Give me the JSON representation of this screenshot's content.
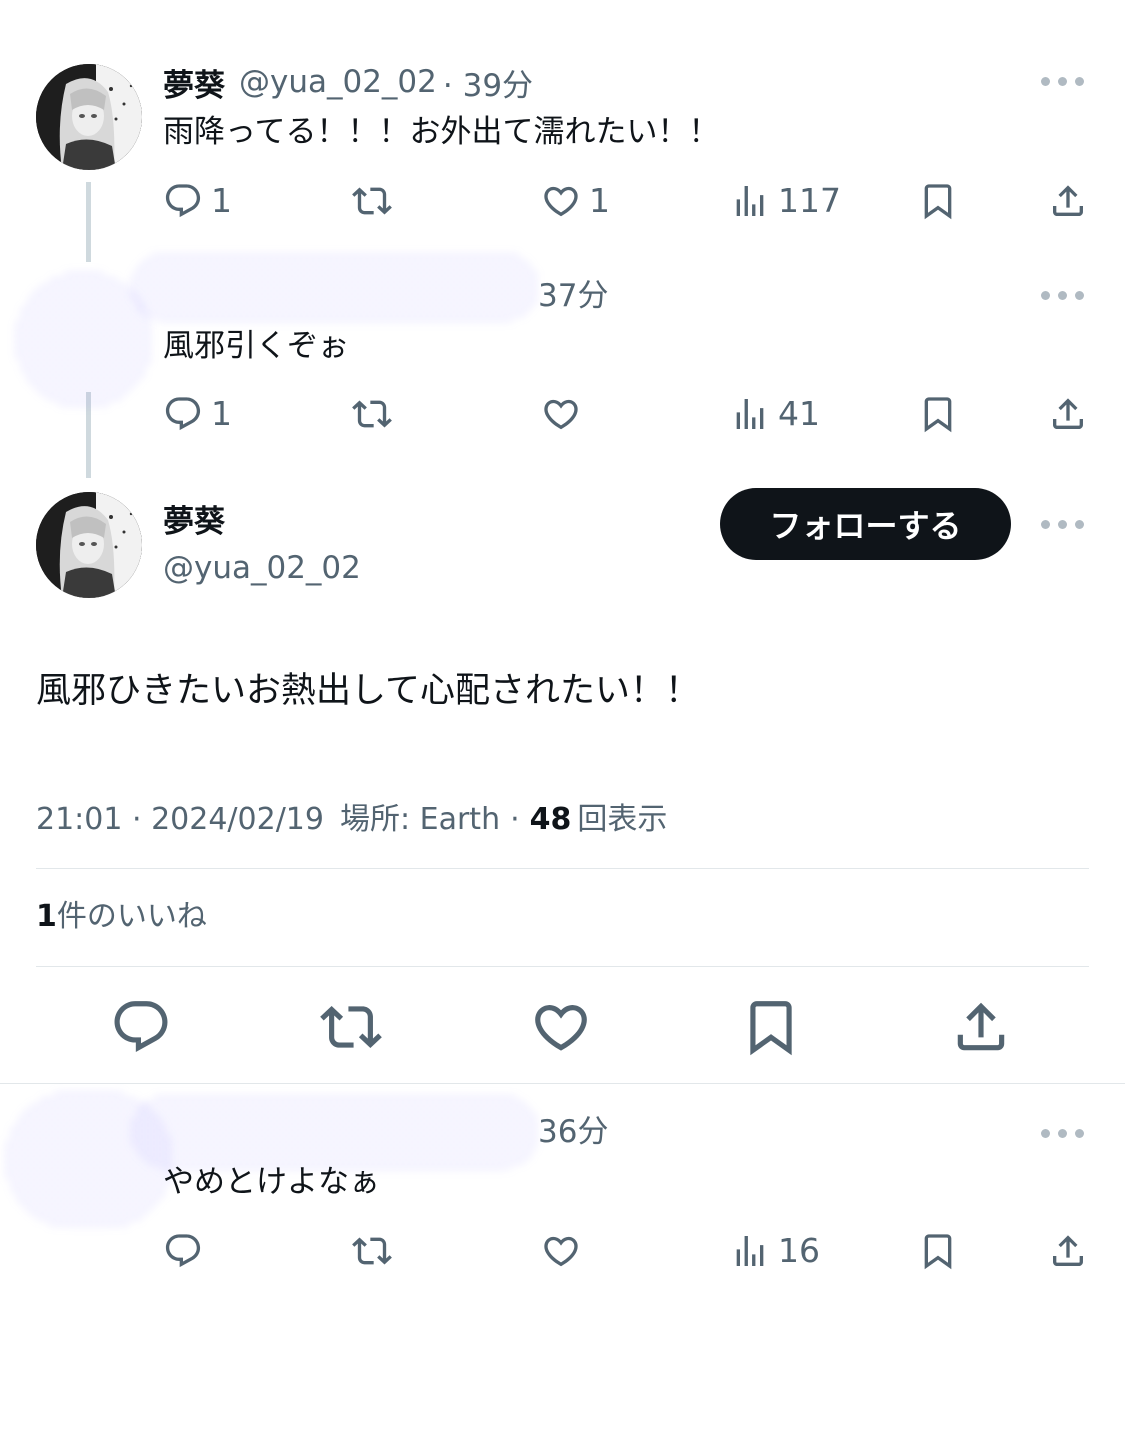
{
  "tweets": {
    "first": {
      "display_name": "夢葵",
      "handle": "@yua_02_02",
      "time": "· 39分",
      "text": "雨降ってる！！！お外出て濡れたい！！",
      "replies": "1",
      "likes": "1",
      "views": "117"
    },
    "reply1": {
      "time": "37分",
      "text": "風邪引くぞぉ",
      "replies": "1",
      "views": "41"
    },
    "main": {
      "display_name": "夢葵",
      "handle": "@yua_02_02",
      "follow_label": "フォローする",
      "text": "風邪ひきたいお熱出して心配されたい！！",
      "timestamp": "21:01 · 2024/02/19",
      "location_label": "場所: Earth",
      "views_sep": "·",
      "views_count": "48",
      "views_label": "回表示",
      "likes_count": "1",
      "likes_label": "件のいいね"
    },
    "reply2": {
      "time": "36分",
      "text": "やめとけよなぁ",
      "views": "16"
    }
  },
  "icons": {
    "reply": "reply-icon",
    "retweet": "retweet-icon",
    "like": "heart-icon",
    "views": "views-icon",
    "bookmark": "bookmark-icon",
    "share": "share-icon",
    "more": "more-icon"
  },
  "colors": {
    "text": "#0f1419",
    "secondary": "#536471",
    "follow_bg": "#0f1419",
    "thread_line": "#cfd9de",
    "redaction": "#2b2486"
  }
}
